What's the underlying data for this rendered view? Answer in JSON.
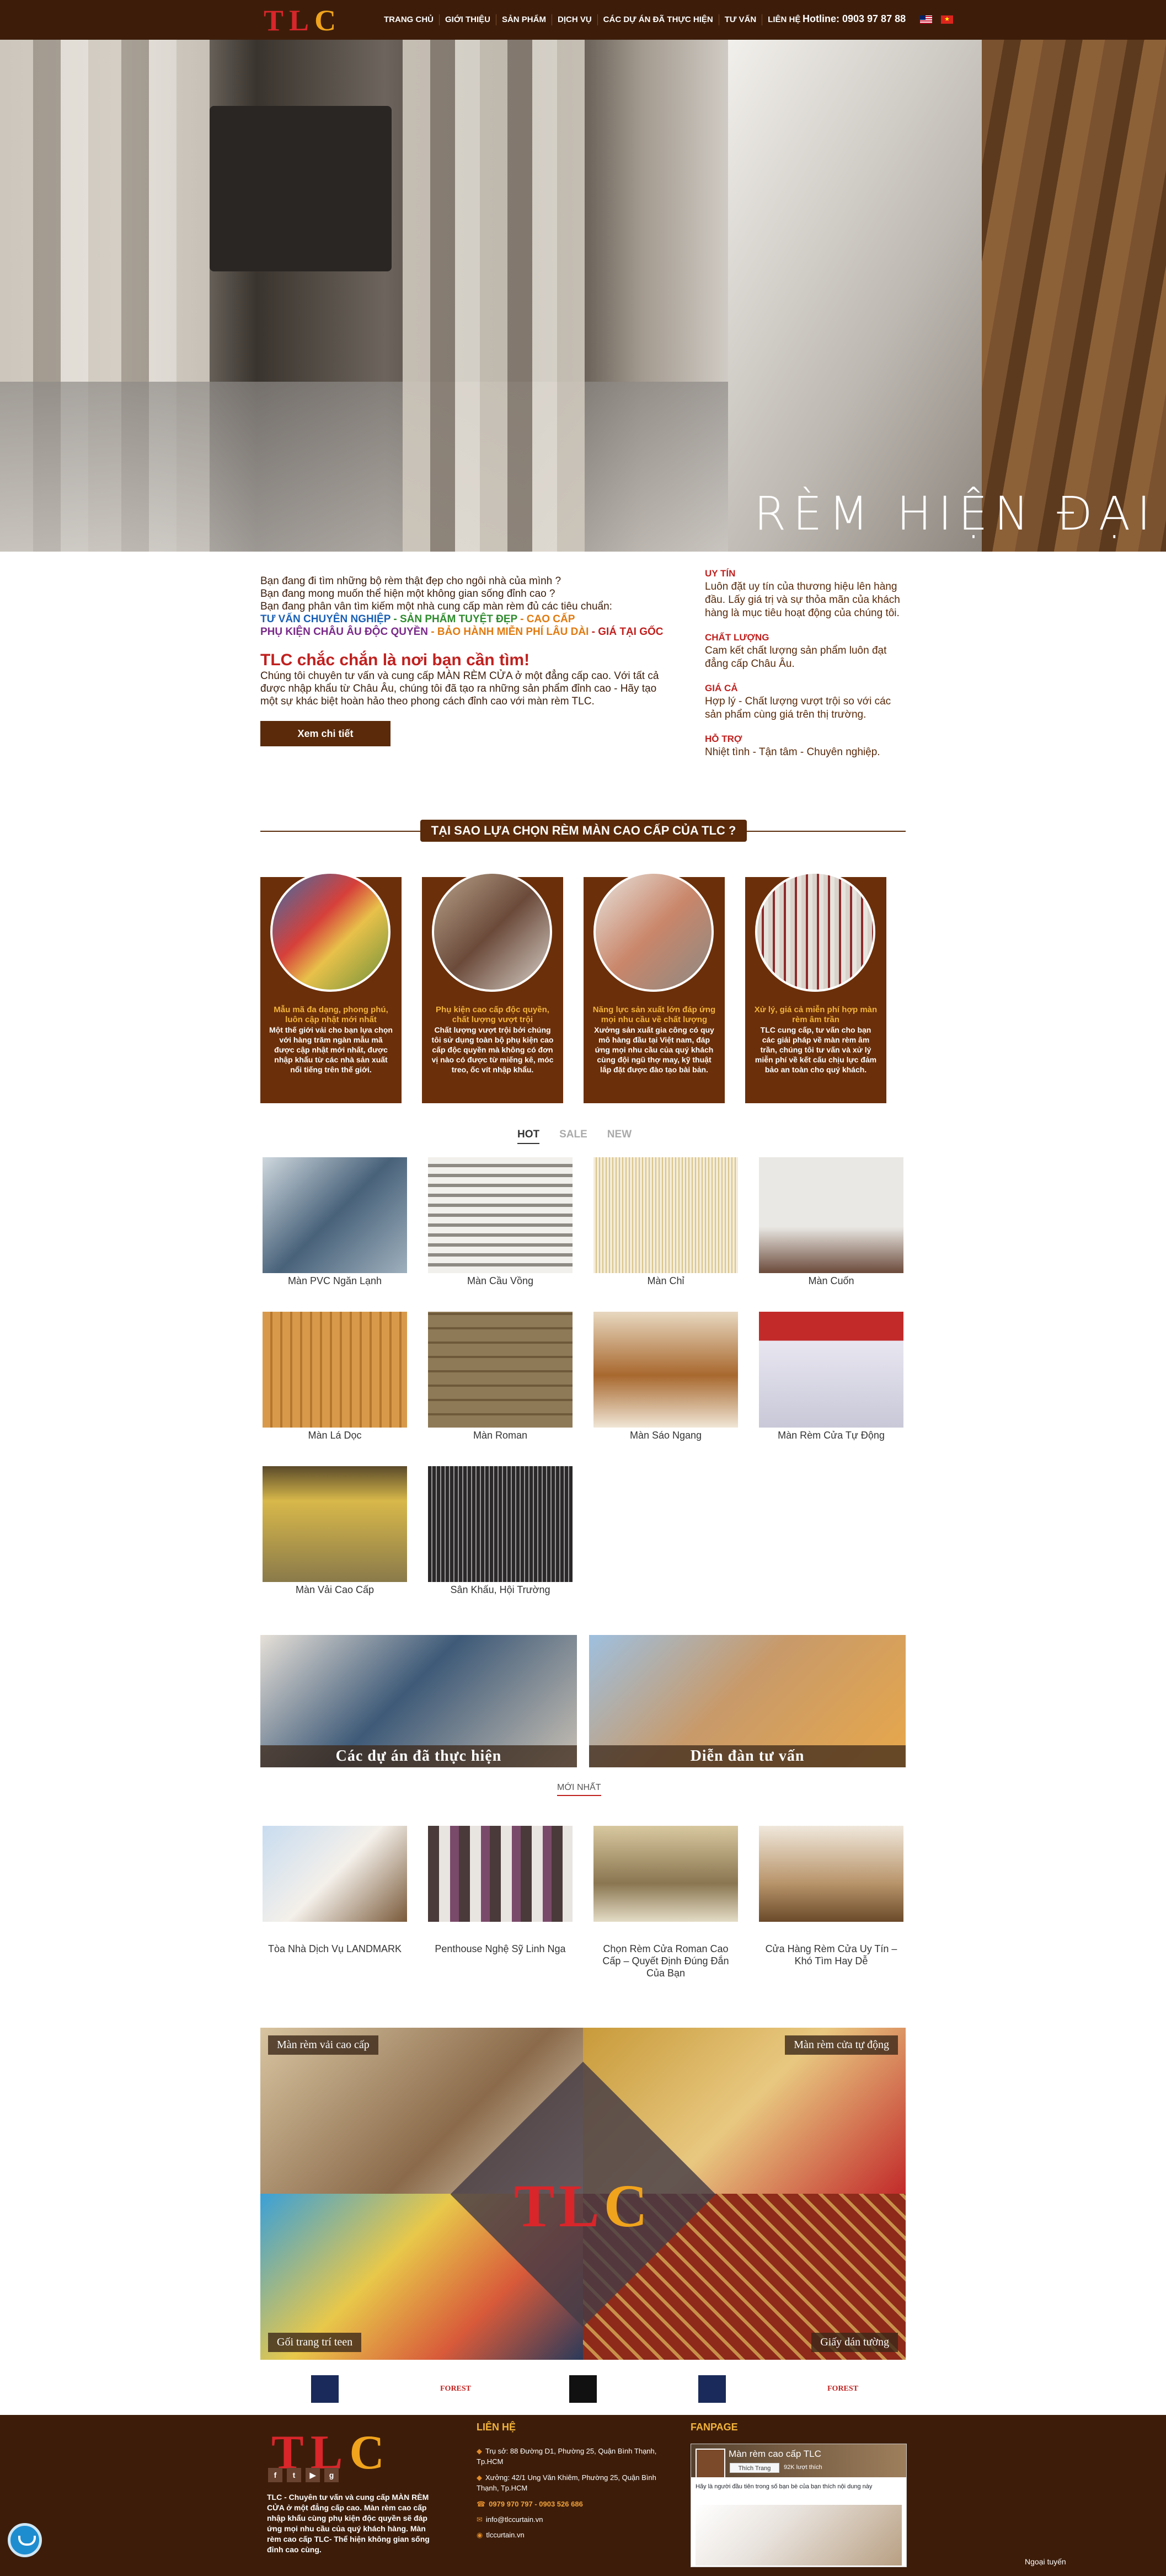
{
  "header": {
    "logo": {
      "t": "T",
      "l": "L",
      "c": "C"
    },
    "nav": [
      "TRANG CHỦ",
      "GIỚI THIỆU",
      "SẢN PHẨM",
      "DỊCH VỤ",
      "CÁC DỰ ÁN ĐÃ THỰC HIỆN",
      "TƯ VẤN",
      "LIÊN HỆ"
    ],
    "hotline": "Hotline: 0903 97 87 88"
  },
  "hero": {
    "caption": "RÈM HIỆN ĐẠI"
  },
  "intro": {
    "line1": "Bạn đang đi tìm những bộ rèm thật đẹp cho ngôi nhà của mình ?",
    "line2": "Bạn đang mong muốn thể hiện một không gian sống đỉnh cao ?",
    "line3": "Bạn đang phân vân tìm kiếm một nhà cung cấp màn rèm đủ các tiêu chuẩn:",
    "tv": "TƯ VẤN CHUYÊN NGHIỆP",
    "sp": "SẢN PHẨM TUYỆT ĐẸP",
    "cl": "CAO CẤP",
    "pk": "PHỤ KIỆN CHÂU ÂU ĐỘC QUYỀN",
    "bh": "BẢO HÀNH MIỄN PHÍ LÂU DÀI",
    "gia": "GIÁ TẠI GỐC",
    "sep": " - ",
    "heading": "TLC chắc chắn là nơi bạn cần tìm!",
    "body": "Chúng tôi chuyên tư vấn và cung cấp MÀN RÈM CỬA ở một đẳng cấp cao. Với tất cả được nhập khẩu từ Châu Âu, chúng tôi đã tạo ra những sản phẩm đỉnh cao - Hãy tạo một sự khác biệt hoàn hảo theo phong cách đỉnh cao với màn rèm TLC.",
    "button": "Xem chi tiết"
  },
  "trust": [
    {
      "title": "UY TÍN",
      "text": "Luôn đặt uy tín của thương hiệu lên hàng đầu. Lấy giá trị và sự thỏa mãn của khách hàng là mục tiêu hoạt động của chúng tôi."
    },
    {
      "title": "CHẤT LƯỢNG",
      "text": "Cam kết chất lượng sản phẩm luôn đạt đẳng cấp Châu Âu."
    },
    {
      "title": "GIÁ CẢ",
      "text": "Hợp lý - Chất lượng vượt trội so với các sản phẩm cùng giá trên thị trường."
    },
    {
      "title": "HỖ TRỢ",
      "text": "Nhiệt tình - Tận tâm - Chuyên nghiệp."
    }
  ],
  "why": {
    "title": "TẠI SAO LỰA CHỌN RÈM MÀN CAO CẤP CỦA TLC ?",
    "cards": [
      {
        "title": "Mẫu mã đa dạng, phong phú, luôn cập nhật mới nhất",
        "text": "Một thế giới vải cho bạn lựa chọn với hàng trăm ngàn mẫu mã được cập nhật mới nhất, được nhập khẩu từ các nhà sản xuất nổi tiếng trên thế giới."
      },
      {
        "title": "Phụ kiện cao cấp độc quyền, chất lượng vượt trội",
        "text": "Chất lượng vượt trội bởi chúng tôi sử dụng toàn bộ phụ kiện cao cấp độc quyền mà không có đơn vị nào có được từ miếng kê, móc treo, ốc vít nhập khẩu."
      },
      {
        "title": "Năng lực sản xuất lớn đáp ứng mọi nhu cầu về chất lượng",
        "text": "Xưởng sản xuất gia công có quy mô hàng đầu tại Việt nam, đáp ứng mọi nhu cầu của quý khách cùng đội ngũ thợ may, kỹ thuật lắp đặt được đào tạo bài bản."
      },
      {
        "title": "Xử lý, giá cả miễn phí hợp màn rèm âm trần",
        "text": "TLC cung cấp, tư vấn cho bạn các giải pháp về màn rèm âm trần, chúng tôi tư vấn và xử lý miễn phí về kết cấu chịu lực đảm bảo an toàn cho quý khách."
      }
    ]
  },
  "tabs": [
    "HOT",
    "SALE",
    "NEW"
  ],
  "products": [
    "Màn PVC Ngăn Lạnh",
    "Màn Cầu Vồng",
    "Màn Chỉ",
    "Màn Cuốn",
    "Màn Lá Dọc",
    "Màn Roman",
    "Màn Sáo Ngang",
    "Màn Rèm Cửa Tự Động",
    "Màn Vải Cao Cấp",
    "Sân Khấu, Hội Trường"
  ],
  "banners": [
    "Các dự án đã thực hiện",
    "Diễn đàn tư vấn"
  ],
  "newest": {
    "label": "MỚI NHẤT",
    "items": [
      "Tòa Nhà Dịch Vụ LANDMARK",
      "Penthouse Nghệ Sỹ Linh Nga",
      "Chọn Rèm Cửa Roman Cao Cấp – Quyết Định Đúng Đắn Của Bạn",
      "Cửa Hàng Rèm Cửa Uy Tín – Khó Tìm Hay Dễ"
    ]
  },
  "collage": {
    "tags": [
      "Màn rèm vải cao cấp",
      "Màn rèm cửa tự động",
      "Gối trang trí teen",
      "Giấy dán tường"
    ]
  },
  "footer": {
    "desc": "TLC - Chuyên tư vấn và cung cấp MÀN RÈM CỬA ở một đẳng cấp cao. Màn rèm cao cấp nhập khẩu cùng phụ kiện độc quyền sẽ đáp ứng mọi nhu cầu của quý khách hàng. Màn rèm cao cấp TLC- Thể hiện không gian sống đỉnh cao cùng.",
    "contact_head": "LIÊN HỆ",
    "contact": [
      "Trụ sở: 88 Đường D1, Phường 25, Quận Bình Thạnh, Tp.HCM",
      "Xưởng: 42/1 Ung Văn Khiêm, Phường 25, Quận Bình Thạnh, Tp.HCM",
      "0979 970 797 - 0903 526 686",
      "info@tlccurtain.vn",
      "tlccurtain.vn"
    ],
    "fanpage_head": "FANPAGE",
    "fb_name": "Màn rèm cao cấp TLC",
    "fb_like": "Thích Trang",
    "fb_likes": "92K lượt thích",
    "fb_post": "Hãy là người đầu tiên trong số bạn bè của bạn thích nội dung này",
    "online": "Ngoại tuyến"
  }
}
